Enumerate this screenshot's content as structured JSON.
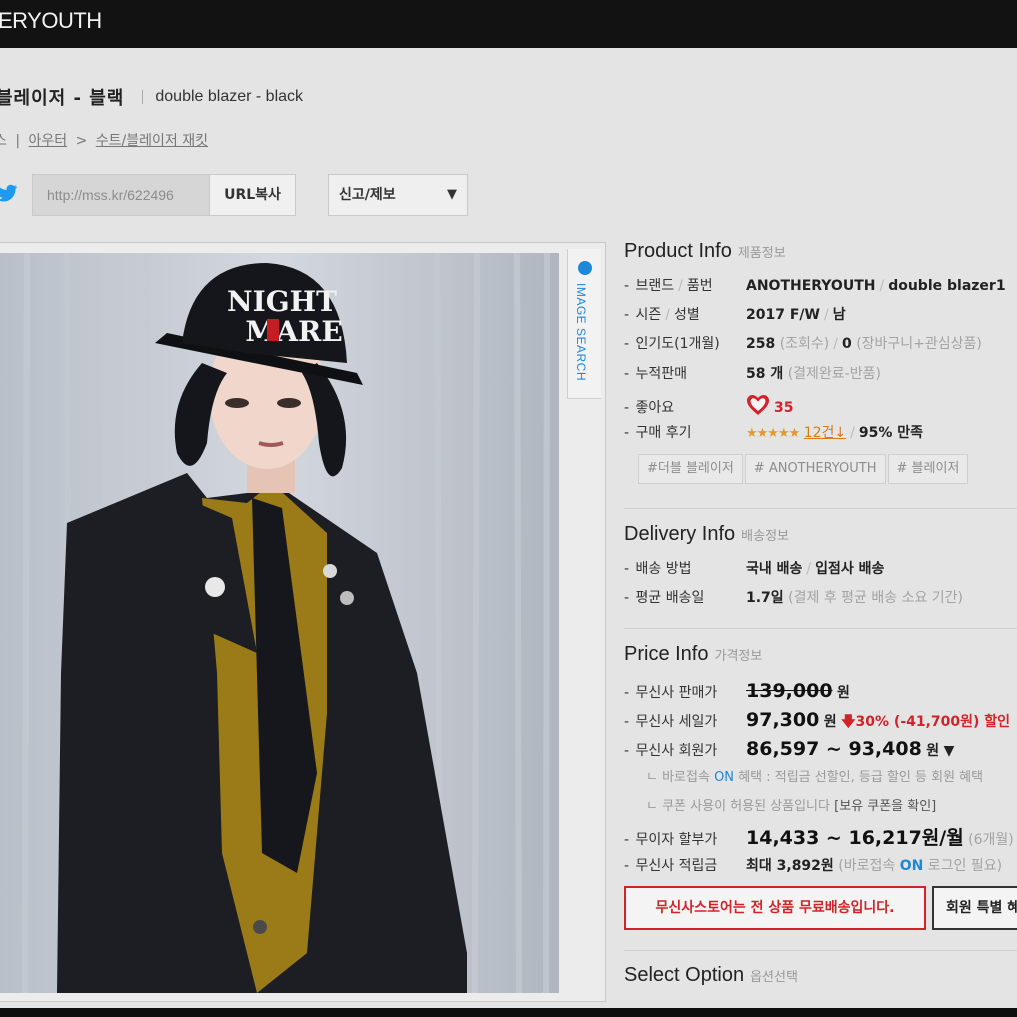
{
  "header": {
    "logo": "ERYOUTH"
  },
  "title": {
    "ko": "블레이저 - 블랙",
    "en": "double blazer - black"
  },
  "breadcrumb": {
    "b0": "스",
    "b1": "아우터",
    "b2": "수트/블레이저 재킷"
  },
  "share": {
    "url": "http://mss.kr/622496",
    "copy": "URL복사",
    "report": "신고/제보",
    "report_arrow": "▼"
  },
  "image_search": "IMAGE SEARCH",
  "product_info": {
    "title": "Product Info",
    "title_ko": "제품정보",
    "brand_label": "브랜드",
    "brand_label2": "품번",
    "brand": "ANOTHERYOUTH",
    "code": "double blazer1",
    "season_label": "시즌",
    "season_label2": "성별",
    "season": "2017 F/W",
    "gender": "남",
    "pop_label": "인기도(1개월)",
    "views": "258",
    "views_unit": "(조회수)",
    "cart": "0",
    "cart_unit": "(장바구니+관심상품)",
    "sales_label": "누적판매",
    "sales": "58 개",
    "sales_unit": "(결제완료-반품)",
    "like_label": "좋아요",
    "likes": "35",
    "review_label": "구매 후기",
    "stars": "★★★★★",
    "reviews": "12건↓",
    "satisfaction": "95% 만족",
    "tags": [
      "#더블 블레이저",
      "# ANOTHERYOUTH",
      "# 블레이저"
    ]
  },
  "delivery_info": {
    "title": "Delivery Info",
    "title_ko": "배송정보",
    "method_label": "배송 방법",
    "method": "국내 배송",
    "method2": "입점사 배송",
    "avg_label": "평균 배송일",
    "avg": "1.7일",
    "avg_note": "(결제 후 평균 배송 소요 기간)"
  },
  "price_info": {
    "title": "Price Info",
    "title_ko": "가격정보",
    "list_label": "무신사 판매가",
    "list_price": "139,000",
    "won": "원",
    "sale_label": "무신사 세일가",
    "sale_price": "97,300",
    "discount": "30% (-41,700원) 할인",
    "member_label": "무신사 회원가",
    "member_price": "86,597 ~ 93,408",
    "note1_pre": "ㄴ 바로접속",
    "note1_on": "ON",
    "note1_post": "혜택 : 적립금 선할인, 등급 할인 등 회원 혜택",
    "note2_pre": "ㄴ 쿠폰 사용이 허용된 상품입니다",
    "note2_link": "[보유 쿠폰을 확인]",
    "install_label": "무이자 할부가",
    "install": "14,433 ~ 16,217원/월",
    "install_note": "(6개월)",
    "point_label": "무신사 적립금",
    "point": "최대 3,892원",
    "point_note1": "(바로접속",
    "point_on": "ON",
    "point_note2": "로그인 필요)"
  },
  "buttons": {
    "free_ship": "무신사스토어는 전 상품 무료배송입니다.",
    "member": "회원 특별 혜택"
  },
  "select_option": {
    "title": "Select Option",
    "title_ko": "옵션선택"
  }
}
